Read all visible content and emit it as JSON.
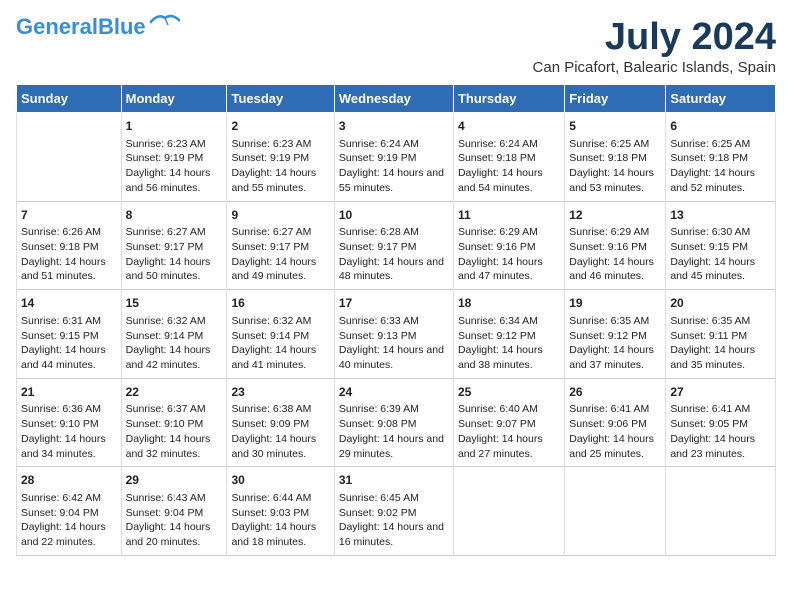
{
  "logo": {
    "line1": "General",
    "line2": "Blue"
  },
  "title": "July 2024",
  "location": "Can Picafort, Balearic Islands, Spain",
  "days_header": [
    "Sunday",
    "Monday",
    "Tuesday",
    "Wednesday",
    "Thursday",
    "Friday",
    "Saturday"
  ],
  "weeks": [
    [
      {
        "day": "",
        "sunrise": "",
        "sunset": "",
        "daylight": ""
      },
      {
        "day": "1",
        "sunrise": "Sunrise: 6:23 AM",
        "sunset": "Sunset: 9:19 PM",
        "daylight": "Daylight: 14 hours and 56 minutes."
      },
      {
        "day": "2",
        "sunrise": "Sunrise: 6:23 AM",
        "sunset": "Sunset: 9:19 PM",
        "daylight": "Daylight: 14 hours and 55 minutes."
      },
      {
        "day": "3",
        "sunrise": "Sunrise: 6:24 AM",
        "sunset": "Sunset: 9:19 PM",
        "daylight": "Daylight: 14 hours and 55 minutes."
      },
      {
        "day": "4",
        "sunrise": "Sunrise: 6:24 AM",
        "sunset": "Sunset: 9:18 PM",
        "daylight": "Daylight: 14 hours and 54 minutes."
      },
      {
        "day": "5",
        "sunrise": "Sunrise: 6:25 AM",
        "sunset": "Sunset: 9:18 PM",
        "daylight": "Daylight: 14 hours and 53 minutes."
      },
      {
        "day": "6",
        "sunrise": "Sunrise: 6:25 AM",
        "sunset": "Sunset: 9:18 PM",
        "daylight": "Daylight: 14 hours and 52 minutes."
      }
    ],
    [
      {
        "day": "7",
        "sunrise": "Sunrise: 6:26 AM",
        "sunset": "Sunset: 9:18 PM",
        "daylight": "Daylight: 14 hours and 51 minutes."
      },
      {
        "day": "8",
        "sunrise": "Sunrise: 6:27 AM",
        "sunset": "Sunset: 9:17 PM",
        "daylight": "Daylight: 14 hours and 50 minutes."
      },
      {
        "day": "9",
        "sunrise": "Sunrise: 6:27 AM",
        "sunset": "Sunset: 9:17 PM",
        "daylight": "Daylight: 14 hours and 49 minutes."
      },
      {
        "day": "10",
        "sunrise": "Sunrise: 6:28 AM",
        "sunset": "Sunset: 9:17 PM",
        "daylight": "Daylight: 14 hours and 48 minutes."
      },
      {
        "day": "11",
        "sunrise": "Sunrise: 6:29 AM",
        "sunset": "Sunset: 9:16 PM",
        "daylight": "Daylight: 14 hours and 47 minutes."
      },
      {
        "day": "12",
        "sunrise": "Sunrise: 6:29 AM",
        "sunset": "Sunset: 9:16 PM",
        "daylight": "Daylight: 14 hours and 46 minutes."
      },
      {
        "day": "13",
        "sunrise": "Sunrise: 6:30 AM",
        "sunset": "Sunset: 9:15 PM",
        "daylight": "Daylight: 14 hours and 45 minutes."
      }
    ],
    [
      {
        "day": "14",
        "sunrise": "Sunrise: 6:31 AM",
        "sunset": "Sunset: 9:15 PM",
        "daylight": "Daylight: 14 hours and 44 minutes."
      },
      {
        "day": "15",
        "sunrise": "Sunrise: 6:32 AM",
        "sunset": "Sunset: 9:14 PM",
        "daylight": "Daylight: 14 hours and 42 minutes."
      },
      {
        "day": "16",
        "sunrise": "Sunrise: 6:32 AM",
        "sunset": "Sunset: 9:14 PM",
        "daylight": "Daylight: 14 hours and 41 minutes."
      },
      {
        "day": "17",
        "sunrise": "Sunrise: 6:33 AM",
        "sunset": "Sunset: 9:13 PM",
        "daylight": "Daylight: 14 hours and 40 minutes."
      },
      {
        "day": "18",
        "sunrise": "Sunrise: 6:34 AM",
        "sunset": "Sunset: 9:12 PM",
        "daylight": "Daylight: 14 hours and 38 minutes."
      },
      {
        "day": "19",
        "sunrise": "Sunrise: 6:35 AM",
        "sunset": "Sunset: 9:12 PM",
        "daylight": "Daylight: 14 hours and 37 minutes."
      },
      {
        "day": "20",
        "sunrise": "Sunrise: 6:35 AM",
        "sunset": "Sunset: 9:11 PM",
        "daylight": "Daylight: 14 hours and 35 minutes."
      }
    ],
    [
      {
        "day": "21",
        "sunrise": "Sunrise: 6:36 AM",
        "sunset": "Sunset: 9:10 PM",
        "daylight": "Daylight: 14 hours and 34 minutes."
      },
      {
        "day": "22",
        "sunrise": "Sunrise: 6:37 AM",
        "sunset": "Sunset: 9:10 PM",
        "daylight": "Daylight: 14 hours and 32 minutes."
      },
      {
        "day": "23",
        "sunrise": "Sunrise: 6:38 AM",
        "sunset": "Sunset: 9:09 PM",
        "daylight": "Daylight: 14 hours and 30 minutes."
      },
      {
        "day": "24",
        "sunrise": "Sunrise: 6:39 AM",
        "sunset": "Sunset: 9:08 PM",
        "daylight": "Daylight: 14 hours and 29 minutes."
      },
      {
        "day": "25",
        "sunrise": "Sunrise: 6:40 AM",
        "sunset": "Sunset: 9:07 PM",
        "daylight": "Daylight: 14 hours and 27 minutes."
      },
      {
        "day": "26",
        "sunrise": "Sunrise: 6:41 AM",
        "sunset": "Sunset: 9:06 PM",
        "daylight": "Daylight: 14 hours and 25 minutes."
      },
      {
        "day": "27",
        "sunrise": "Sunrise: 6:41 AM",
        "sunset": "Sunset: 9:05 PM",
        "daylight": "Daylight: 14 hours and 23 minutes."
      }
    ],
    [
      {
        "day": "28",
        "sunrise": "Sunrise: 6:42 AM",
        "sunset": "Sunset: 9:04 PM",
        "daylight": "Daylight: 14 hours and 22 minutes."
      },
      {
        "day": "29",
        "sunrise": "Sunrise: 6:43 AM",
        "sunset": "Sunset: 9:04 PM",
        "daylight": "Daylight: 14 hours and 20 minutes."
      },
      {
        "day": "30",
        "sunrise": "Sunrise: 6:44 AM",
        "sunset": "Sunset: 9:03 PM",
        "daylight": "Daylight: 14 hours and 18 minutes."
      },
      {
        "day": "31",
        "sunrise": "Sunrise: 6:45 AM",
        "sunset": "Sunset: 9:02 PM",
        "daylight": "Daylight: 14 hours and 16 minutes."
      },
      {
        "day": "",
        "sunrise": "",
        "sunset": "",
        "daylight": ""
      },
      {
        "day": "",
        "sunrise": "",
        "sunset": "",
        "daylight": ""
      },
      {
        "day": "",
        "sunrise": "",
        "sunset": "",
        "daylight": ""
      }
    ]
  ]
}
